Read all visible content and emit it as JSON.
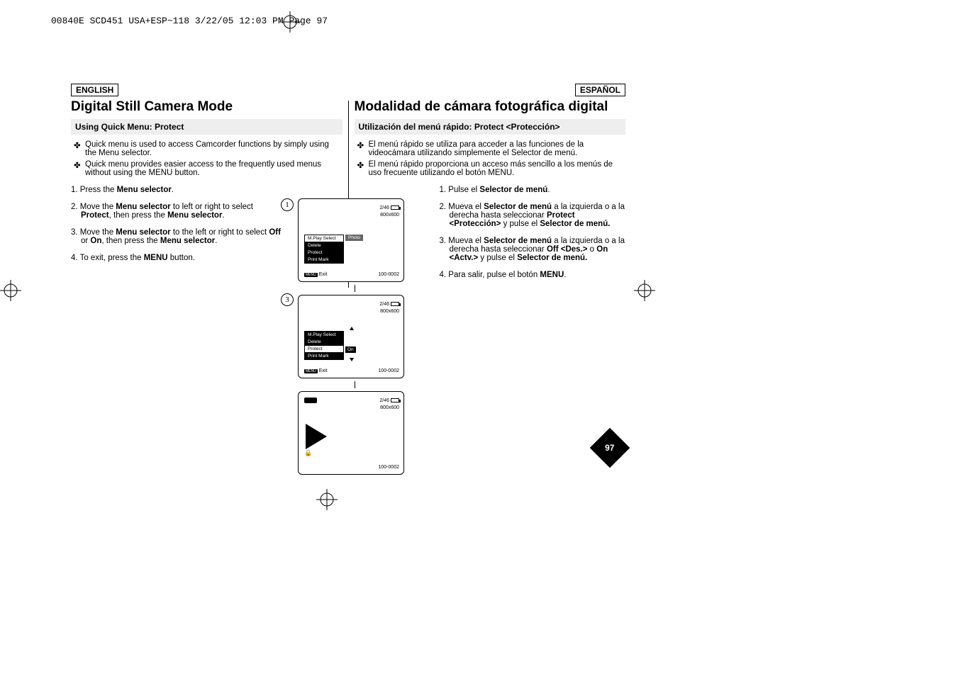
{
  "header_raw": "00840E SCD451 USA+ESP~118  3/22/05 12:03 PM  Page 97",
  "page_number": "97",
  "english": {
    "lang": "ENGLISH",
    "title": "Digital Still Camera Mode",
    "subtitle": "Using Quick Menu: Protect",
    "bullets": [
      "Quick menu is used to access Camcorder functions by simply using the Menu selector.",
      "Quick menu provides easier access to the frequently used menus without using the MENU button."
    ],
    "steps": {
      "s1_a": "1. Press the ",
      "s1_b": "Menu selector",
      "s1_c": ".",
      "s2_a": "2. Move the ",
      "s2_b": "Menu selector",
      "s2_c": " to left or right to select ",
      "s2_d": "Protect",
      "s2_e": ", then press the ",
      "s2_f": "Menu selector",
      "s2_g": ".",
      "s3_a": "3. Move the ",
      "s3_b": "Menu selector",
      "s3_c": " to the left or right to select ",
      "s3_d": "Off",
      "s3_e": " or ",
      "s3_f": "On",
      "s3_g": ", then press the ",
      "s3_h": "Menu selector",
      "s3_i": ".",
      "s4_a": "4. To exit, press the ",
      "s4_b": "MENU",
      "s4_c": " button."
    }
  },
  "spanish": {
    "lang": "ESPAÑOL",
    "title": "Modalidad de cámara fotográfica digital",
    "subtitle": "Utilización del menú rápido: Protect <Protección>",
    "bullets": [
      "El menú rápido se utiliza para acceder a las funciones de la videocámara utilizando simplemente el Selector de menú.",
      "El menú rápido proporciona un acceso más sencillo a los menús de uso frecuente utilizando el botón MENU."
    ],
    "steps": {
      "s1_a": "1. Pulse el ",
      "s1_b": "Selector de menú",
      "s1_c": ".",
      "s2_a": "2. Mueva el ",
      "s2_b": "Selector de menú",
      "s2_c": " a la izquierda o a la derecha hasta seleccionar ",
      "s2_d": "Protect <Protección>",
      "s2_e": " y pulse el ",
      "s2_f": "Selector de menú.",
      "s3_a": "3. Mueva el ",
      "s3_b": "Selector de menú",
      "s3_c": " a la izquierda o a la derecha hasta seleccionar ",
      "s3_d": "Off <Des.>",
      "s3_e": " o ",
      "s3_f": "On <Actv.>",
      "s3_g": " y pulse el ",
      "s3_h": "Selector de menú.",
      "s4_a": "4. Para salir, pulse el botón ",
      "s4_b": "MENU",
      "s4_c": "."
    }
  },
  "screens": {
    "counter": "2/46",
    "res": "800x600",
    "folder": "100-0002",
    "menu_items": [
      "M.Play Select",
      "Delete",
      "Protect",
      "Print Mark"
    ],
    "photo_label": "Photo",
    "on_label": "On",
    "exit_label": "Exit",
    "menu_key": "MENU"
  },
  "step_markers": {
    "one": "1",
    "three": "3"
  }
}
